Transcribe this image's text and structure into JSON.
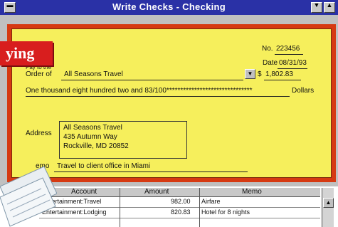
{
  "window": {
    "title": "Write Checks - Checking"
  },
  "banner": {
    "text": "ying"
  },
  "check": {
    "number_label": "No.",
    "number_value": "223456",
    "date_label": "Date",
    "date_value": "08/31/93",
    "payee_label_line1": "Pay to the",
    "payee_label_line2": "Order of",
    "payee_value": "All Seasons Travel",
    "dollar_sign": "$",
    "amount_value": "1,802.83",
    "amount_words": "One thousand eight hundred two and 83/100*******************************",
    "dollars_label": "Dollars",
    "address_label": "Address",
    "address_lines": [
      "All Seasons Travel",
      "435 Autumn Way",
      "Rockville, MD 20852"
    ],
    "memo_label": "emo",
    "memo_value": "Travel to client office in Miami"
  },
  "register": {
    "columns": [
      "Account",
      "Amount",
      "Memo"
    ],
    "rows": [
      {
        "account": "Entertainment:Travel",
        "amount": "982.00",
        "memo": "Airfare"
      },
      {
        "account": "Entertainment:Lodging",
        "amount": "820.83",
        "memo": "Hotel for 8 nights"
      }
    ]
  },
  "icons": {
    "system_menu": "system-menu-icon",
    "minimize": "minimize-icon",
    "maximize": "maximize-icon",
    "dropdown": "dropdown-arrow-icon",
    "scroll_up": "scroll-up-arrow-icon"
  },
  "colors": {
    "titlebar": "#2a31a6",
    "check_background": "#f6ef5c",
    "check_border": "#d63a12",
    "banner": "#d81e1e"
  }
}
